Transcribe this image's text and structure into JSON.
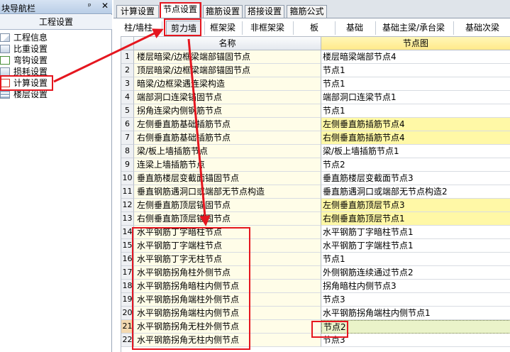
{
  "nav": {
    "title": "块导航栏",
    "pin_glyph": "ᵖ",
    "close_glyph": "✕",
    "section": "工程设置",
    "items": [
      {
        "label": "工程信息",
        "icon": "document-icon"
      },
      {
        "label": "比重设置",
        "icon": "weight-icon"
      },
      {
        "label": "弯钩设置",
        "icon": "hook-icon"
      },
      {
        "label": "损耗设置",
        "icon": "loss-icon"
      },
      {
        "label": "计算设置",
        "icon": "calculator-icon"
      },
      {
        "label": "楼层设置",
        "icon": "floor-icon"
      }
    ]
  },
  "tabs": [
    "计算设置",
    "节点设置",
    "箍筋设置",
    "搭接设置",
    "箍筋公式"
  ],
  "active_tab": "节点设置",
  "subtabs": [
    "柱/墙柱",
    "剪力墙",
    "框架梁",
    "非框架梁",
    "板",
    "基础",
    "基础主梁/承台梁",
    "基础次梁"
  ],
  "active_subtab": "剪力墙",
  "grid": {
    "headers": {
      "name": "名称",
      "node": "节点图"
    },
    "rows": [
      {
        "idx": "1",
        "name": "楼层暗梁/边框梁端部锚固节点",
        "node": "楼层暗梁端部节点4"
      },
      {
        "idx": "2",
        "name": "顶层暗梁/边框梁端部锚固节点",
        "node": "节点1"
      },
      {
        "idx": "3",
        "name": "暗梁/边框梁遇连梁构造",
        "node": "节点1"
      },
      {
        "idx": "4",
        "name": "端部洞口连梁锚固节点",
        "node": "端部洞口连梁节点1"
      },
      {
        "idx": "5",
        "name": "拐角连梁内侧钢筋节点",
        "node": "节点1"
      },
      {
        "idx": "6",
        "name": "左侧垂直筋基础插筋节点",
        "node": "左侧垂直筋插筋节点4"
      },
      {
        "idx": "7",
        "name": "右侧垂直筋基础插筋节点",
        "node": "右侧垂直筋插筋节点4"
      },
      {
        "idx": "8",
        "name": "梁/板上墙插筋节点",
        "node": "梁/板上墙插筋节点1"
      },
      {
        "idx": "9",
        "name": "连梁上墙插筋节点",
        "node": "节点2"
      },
      {
        "idx": "10",
        "name": "垂直筋楼层变截面锚固节点",
        "node": "垂直筋楼层变截面节点3"
      },
      {
        "idx": "11",
        "name": "垂直钢筋遇洞口或端部无节点构造",
        "node": "垂直筋遇洞口或端部无节点构造2"
      },
      {
        "idx": "12",
        "name": "左侧垂直筋顶层锚固节点",
        "node": "左侧垂直筋顶层节点3"
      },
      {
        "idx": "13",
        "name": "右侧垂直筋顶层锚固节点",
        "node": "右侧垂直筋顶层节点1"
      },
      {
        "idx": "14",
        "name": "水平钢筋丁字暗柱节点",
        "node": "水平钢筋丁字暗柱节点1"
      },
      {
        "idx": "15",
        "name": "水平钢筋丁字端柱节点",
        "node": "水平钢筋丁字端柱节点1"
      },
      {
        "idx": "16",
        "name": "水平钢筋丁字无柱节点",
        "node": "节点1"
      },
      {
        "idx": "17",
        "name": "水平钢筋拐角柱外侧节点",
        "node": "外侧钢筋连续通过节点2"
      },
      {
        "idx": "18",
        "name": "水平钢筋拐角暗柱内侧节点",
        "node": "拐角暗柱内侧节点3"
      },
      {
        "idx": "19",
        "name": "水平钢筋拐角端柱外侧节点",
        "node": "节点3"
      },
      {
        "idx": "20",
        "name": "水平钢筋拐角端柱内侧节点",
        "node": "水平钢筋拐角端柱内侧节点1"
      },
      {
        "idx": "21",
        "name": "水平钢筋拐角无柱外侧节点",
        "node": "节点2"
      },
      {
        "idx": "22",
        "name": "水平钢筋拐角无柱内侧节点",
        "node": "节点3"
      }
    ],
    "highlight_rows": [
      "6",
      "7",
      "12",
      "13"
    ],
    "selected_row": "21"
  },
  "colors": {
    "annotation": "#e5161f",
    "name_cell": "#fffde8",
    "highlight_cell": "#fff8a6",
    "selected_cell": "#eaf3c9"
  }
}
